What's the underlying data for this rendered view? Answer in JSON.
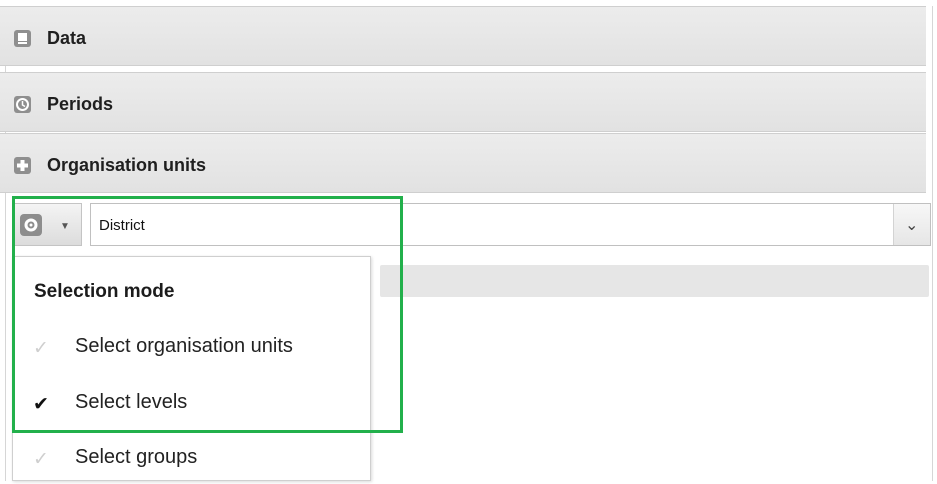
{
  "accordion": {
    "data_label": "Data",
    "periods_label": "Periods",
    "org_units_label": "Organisation units"
  },
  "org_units": {
    "level_value": "District"
  },
  "selection_menu": {
    "title": "Selection mode",
    "items": [
      {
        "label": "Select organisation units",
        "checked": false
      },
      {
        "label": "Select levels",
        "checked": true
      },
      {
        "label": "Select groups",
        "checked": false
      }
    ]
  },
  "colors": {
    "highlight_border": "#22b04b",
    "header_background": "#e7e7e7"
  }
}
